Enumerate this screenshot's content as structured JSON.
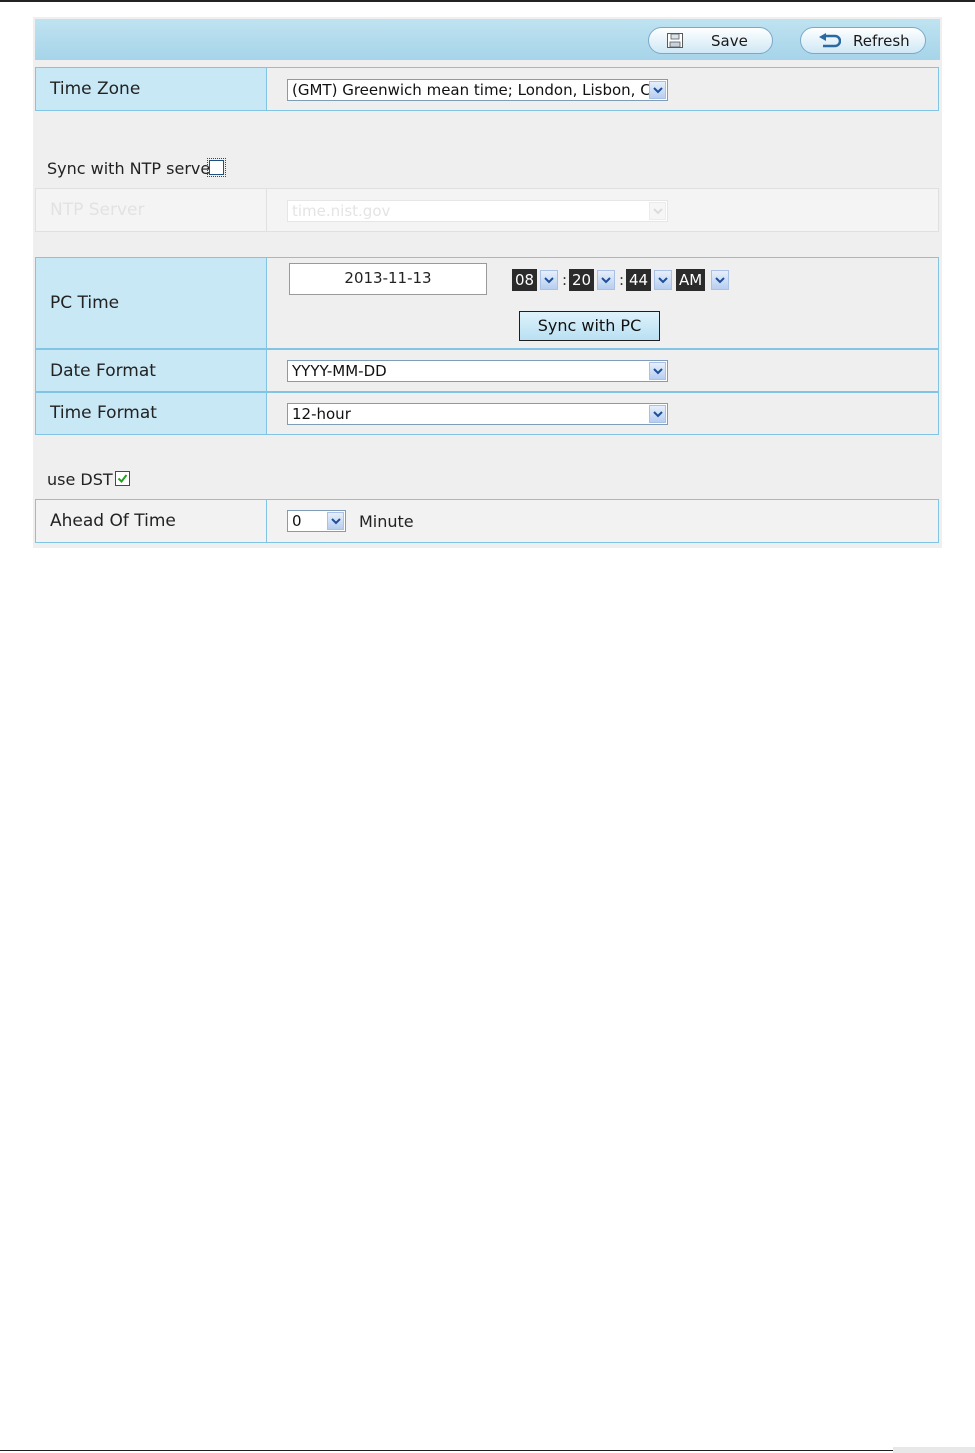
{
  "toolbar": {
    "save_label": "Save",
    "refresh_label": "Refresh"
  },
  "time_zone": {
    "label": "Time Zone",
    "value": "(GMT) Greenwich mean time; London, Lisbon, C"
  },
  "ntp": {
    "sync_label": "Sync with NTP server",
    "sync_checked": false,
    "server_label": "NTP Server",
    "server_value": "time.nist.gov"
  },
  "pc_time": {
    "label": "PC Time",
    "date": "2013-11-13",
    "hour": "08",
    "minute": "20",
    "second": "44",
    "ampm": "AM",
    "sync_button": "Sync with PC",
    "separator": ":"
  },
  "date_format": {
    "label": "Date Format",
    "value": "YYYY-MM-DD"
  },
  "time_format": {
    "label": "Time Format",
    "value": "12-hour"
  },
  "dst": {
    "label": "use DST",
    "checked": true
  },
  "ahead_of_time": {
    "label": "Ahead Of Time",
    "value": "0",
    "unit": "Minute"
  }
}
